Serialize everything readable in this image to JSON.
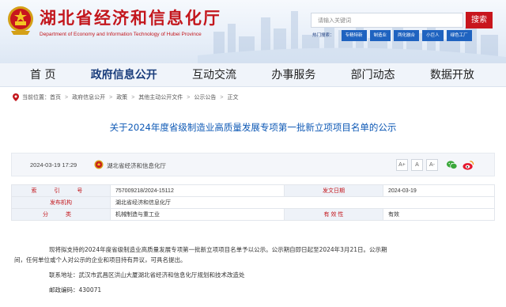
{
  "header": {
    "title": "湖北省经济和信息化厅",
    "subtitle": "Department of Economy and Information Technology of Hubei Province",
    "search_placeholder": "请输入关键词",
    "search_button": "搜索",
    "quick_links": [
      "热门搜索：",
      "专精特新",
      "制造业",
      "两化融合",
      "小巨人",
      "绿色工厂"
    ]
  },
  "nav": [
    "首  页",
    "政府信息公开",
    "互动交流",
    "办事服务",
    "部门动态",
    "数据开放"
  ],
  "breadcrumb": {
    "label": "当前位置：",
    "items": [
      "首页",
      "政府信息公开",
      "政策",
      "其他主动公开文件",
      "公示公告",
      "正文"
    ]
  },
  "article": {
    "title": "关于2024年度省级制造业高质量发展专项第一批新立项项目名单的公示",
    "date": "2024-03-19 17:29",
    "source": "湖北省经济和信息化厅",
    "font_sizes": [
      "A+",
      "A",
      "A-"
    ],
    "share_icons": [
      "wechat-icon",
      "weibo-icon"
    ]
  },
  "info": {
    "index_label": "索 引 号",
    "index_value": "757009218/2024-15112",
    "date_label": "发文日期",
    "date_value": "2024-03-19",
    "org_label": "发布机构",
    "org_value": "湖北省经济和信息化厅",
    "cat_label": "分 类",
    "cat_value": "机械制造与重工业",
    "valid_label": "有 效 性",
    "valid_value": "有效"
  },
  "body": {
    "p1": "现将拟支持的2024年度省级制造业高质量发展专项第一批新立项项目名单予以公示。公示期自即日起至2024年3月21日。公示期",
    "p1b": "间，任何单位或个人对公示的企业和项目持有异议，可具名提出。",
    "p2": "联系地址：武汉市武昌区洪山大厦湖北省经济和信息化厅规划和技术改造处",
    "p3": "邮政编码：430071"
  },
  "colors": {
    "brand_red": "#c3161c",
    "title_blue": "#0d58b5",
    "link_blue": "#1f63c0"
  }
}
